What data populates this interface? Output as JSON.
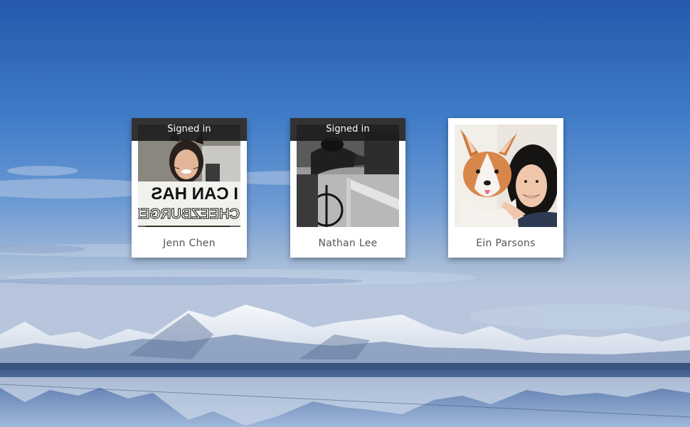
{
  "colors": {
    "card_background": "#ffffff",
    "banner_background": "#1c1c1c",
    "banner_text": "#ffffff",
    "name_text": "#555555",
    "sky_top": "#2a5fb0",
    "sky_bottom": "#a9bfdc"
  },
  "users": [
    {
      "name": "Jenn Chen",
      "status": "Signed in",
      "avatar_sign_line1": "I CAN HAS",
      "avatar_sign_line2": "CHEEZBURGER"
    },
    {
      "name": "Nathan Lee",
      "status": "Signed in"
    },
    {
      "name": "Ein Parsons",
      "status": ""
    }
  ]
}
